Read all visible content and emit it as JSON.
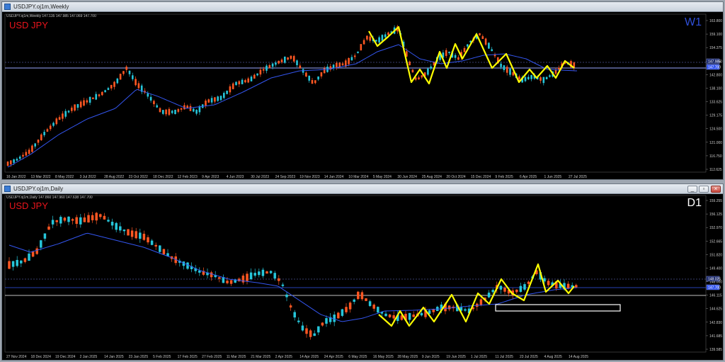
{
  "windows": {
    "weekly": {
      "title": "USDJPY.oj1m,Weekly",
      "info": "USDJPY.oj1m,Weekly  147.135 147.985 147.069 147.700",
      "symbol": "USD JPY",
      "timeframe": "W1",
      "timeframe_color": "#2f4fd8",
      "y_labels": [
        "163.800",
        "159.100",
        "154.375",
        "149.650",
        "142.800",
        "138.100",
        "133.625",
        "129.175",
        "124.500",
        "121.000",
        "116.750",
        "112.625"
      ],
      "current_price": "147.700",
      "current_price_alt": "147.985",
      "x_labels": [
        "16 Jan 2022",
        "13 Mar 2022",
        "8 May 2022",
        "3 Jul 2022",
        "28 Aug 2022",
        "23 Oct 2022",
        "18 Dec 2022",
        "12 Feb 2023",
        "9 Apr 2023",
        "4 Jun 2023",
        "30 Jul 2023",
        "24 Sep 2023",
        "19 Nov 2023",
        "14 Jan 2024",
        "10 Mar 2024",
        "5 May 2024",
        "30 Jun 2024",
        "25 Aug 2024",
        "20 Oct 2024",
        "15 Dec 2024",
        "9 Feb 2025",
        "6 Apr 2025",
        "1 Jun 2025",
        "27 Jul 2025"
      ]
    },
    "daily": {
      "title": "USDJPY.oj1m,Daily",
      "info": "USDJPY.oj1m,Daily  147.860 147.960 147.638 147.700",
      "symbol": "USD JPY",
      "timeframe": "D1",
      "timeframe_color": "#ffffff",
      "y_labels": [
        "159.255",
        "156.125",
        "152.970",
        "152.665",
        "151.820",
        "149.400",
        "148.000",
        "146.115",
        "144.625",
        "142.830",
        "141.685",
        "139.585"
      ],
      "current_price": "147.700",
      "current_price_alt": "148.025",
      "x_labels": [
        "27 Nov 2024",
        "18 Dec 2024",
        "19 Dec 2024",
        "2 Jan 2025",
        "14 Jan 2025",
        "23 Jan 2025",
        "5 Feb 2025",
        "17 Feb 2025",
        "27 Feb 2025",
        "11 Mar 2025",
        "21 Mar 2025",
        "2 Apr 2025",
        "14 Apr 2025",
        "24 Apr 2025",
        "6 May 2025",
        "16 May 2025",
        "28 May 2025",
        "9 Jun 2025",
        "19 Jun 2025",
        "1 Jul 2025",
        "11 Jul 2025",
        "23 Jul 2025",
        "4 Aug 2025",
        "14 Aug 2025"
      ]
    }
  },
  "colors": {
    "bull": "#26c6da",
    "bear": "#ff5722",
    "ma": "#3355ee",
    "zigzag": "#ffff00",
    "hline": "#9aa8ff",
    "background": "#000000"
  }
}
